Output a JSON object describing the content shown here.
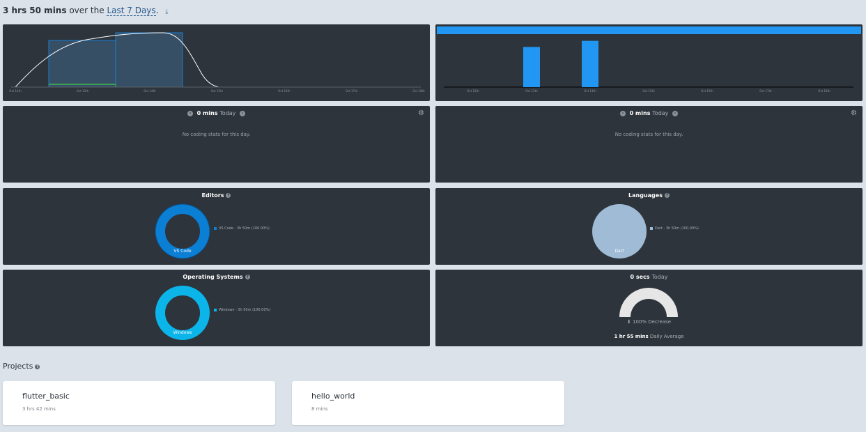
{
  "header": {
    "total": "3 hrs 50 mins",
    "over_text": "over the",
    "range_link": "Last 7 Days",
    "period": ".",
    "download_icon": "download-icon"
  },
  "activity_chart": {
    "x_labels": [
      "Oct 12th",
      "Oct 13th",
      "Oct 14th",
      "Oct 15th",
      "Oct 16th",
      "Oct 17th",
      "Oct 18th"
    ],
    "bars": [
      {
        "day": "Oct 13th",
        "value": 3.5,
        "color": "#1a7fd6"
      },
      {
        "day": "Oct 14th",
        "value": 3.9,
        "color": "#1a7fd6"
      }
    ],
    "green_line_days": [
      "Oct 13th"
    ],
    "curve_color": "#ffffff"
  },
  "bar_chart": {
    "x_labels": [
      "Oct 12th",
      "Oct 13th",
      "Oct 14th",
      "Oct 15th",
      "Oct 16th",
      "Oct 17th",
      "Oct 18th"
    ],
    "values": [
      0,
      0.72,
      0.83,
      0,
      0,
      0,
      0
    ],
    "bar_color": "#2196f3",
    "top_band_color": "#2196f3"
  },
  "today_left": {
    "value": "0 mins",
    "label": "Today",
    "prev_icon": "chevron-left-icon",
    "next_icon": "chevron-right-icon",
    "gear_icon": "gear-icon",
    "empty_text": "No coding stats for this day."
  },
  "today_right": {
    "value": "0 mins",
    "label": "Today",
    "prev_icon": "chevron-left-icon",
    "next_icon": "chevron-right-icon",
    "gear_icon": "gear-icon",
    "empty_text": "No coding stats for this day."
  },
  "editors": {
    "title": "Editors",
    "center_label": "VS Code",
    "legend": "VS Code - 3h 50m (100.00%)",
    "color": "#0a7fd4",
    "help_icon": "help-icon"
  },
  "languages": {
    "title": "Languages",
    "center_label": "Dart",
    "legend": "Dart - 3h 50m (100.00%)",
    "color": "#9fbbd6",
    "help_icon": "help-icon"
  },
  "operating_systems": {
    "title": "Operating Systems",
    "center_label": "Windows",
    "legend": "Windows - 3h 50m (100.00%)",
    "color": "#0bb5ea",
    "help_icon": "help-icon"
  },
  "gauge": {
    "value": "0 secs",
    "label": "Today",
    "decrease_text": "100% Decrease",
    "daily_avg_value": "1 hr 55 mins",
    "daily_avg_label": "Daily Average",
    "arrow_icon": "arrow-down-icon",
    "fill_fraction": 0
  },
  "projects": {
    "title": "Projects",
    "help_icon": "help-icon",
    "items": [
      {
        "name": "flutter_basic",
        "time": "3 hrs 42 mins"
      },
      {
        "name": "hello_world",
        "time": "8 mins"
      }
    ]
  }
}
